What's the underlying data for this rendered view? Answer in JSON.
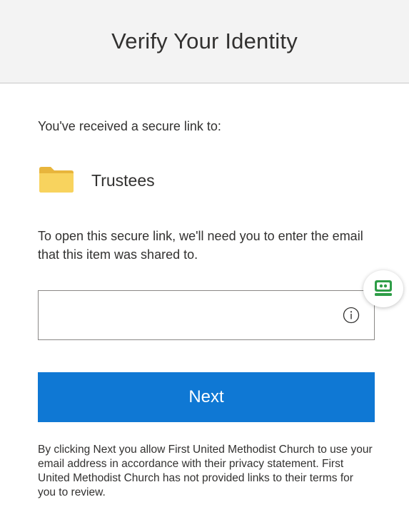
{
  "header": {
    "title": "Verify Your Identity"
  },
  "content": {
    "intro_text": "You've received a secure link to:",
    "item": {
      "icon": "folder-icon",
      "name": "Trustees"
    },
    "instructions": "To open this secure link, we'll need you to enter the email that this item was shared to.",
    "email_field": {
      "value": "",
      "placeholder": "",
      "info_icon": "info-icon"
    },
    "next_label": "Next",
    "disclaimer": "By clicking Next you allow First United Methodist Church to use your email address in accordance with their privacy statement. First United Methodist Church has not provided links to their terms for you to review."
  },
  "extension_badge": {
    "icon": "password-manager-icon"
  },
  "colors": {
    "accent": "#0f78d4",
    "header_bg": "#f3f3f3",
    "folder": "#f8d35e",
    "extension_green": "#2e9d47"
  }
}
